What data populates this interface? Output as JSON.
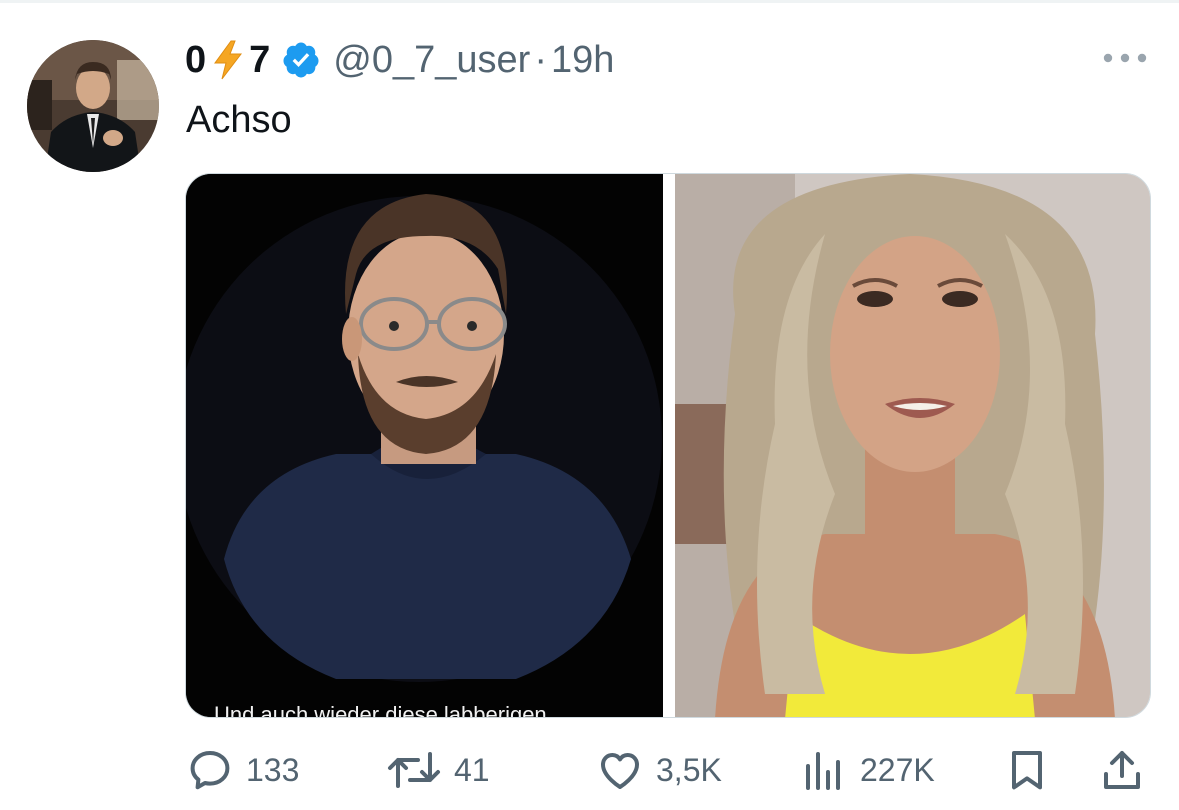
{
  "author": {
    "name_first": "0",
    "name_emoji": "⚡",
    "name_last": "7",
    "verified": true,
    "handle": "@0_7_user",
    "separator": "·",
    "time": "19h"
  },
  "tweet": {
    "text": "Achso"
  },
  "media": {
    "left_caption": "Und auch wieder diese labberigen"
  },
  "actions": {
    "replies": "133",
    "reposts": "41",
    "likes": "3,5K",
    "views": "227K"
  },
  "icons": {
    "more": "more-horizontal-icon",
    "reply": "reply-icon",
    "repost": "repost-icon",
    "like": "heart-icon",
    "views": "views-icon",
    "bookmark": "bookmark-icon",
    "share": "share-icon",
    "verified": "verified-badge-icon"
  },
  "colors": {
    "text": "#0f1419",
    "secondary": "#536471",
    "verified": "#1d9bf0",
    "bolt": "#f5a623"
  }
}
